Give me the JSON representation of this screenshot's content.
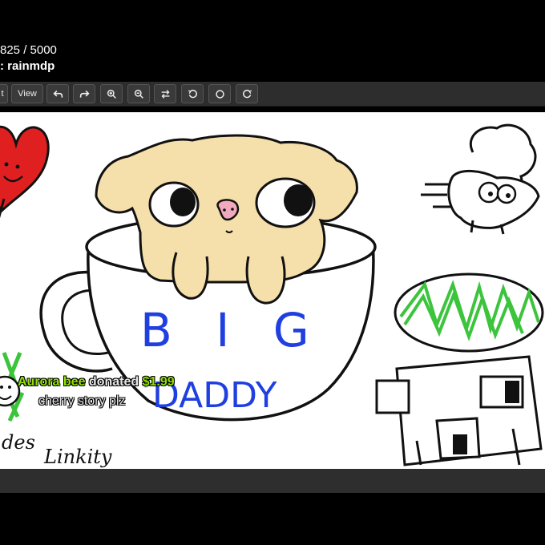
{
  "header": {
    "counter": "825 / 5000",
    "artist": ": rainmdp"
  },
  "toolbar": {
    "first_label": "t",
    "view_label": "View",
    "buttons": [
      {
        "name": "undo-button",
        "icon": "undo-icon"
      },
      {
        "name": "redo-button",
        "icon": "redo-icon"
      },
      {
        "name": "zoom-in-button",
        "icon": "zoom-in-icon"
      },
      {
        "name": "zoom-out-button",
        "icon": "zoom-out-icon"
      },
      {
        "name": "swap-button",
        "icon": "swap-icon"
      },
      {
        "name": "rotate-left-button",
        "icon": "rotate-left-icon"
      },
      {
        "name": "reset-rotation-button",
        "icon": "circle-icon"
      },
      {
        "name": "rotate-right-button",
        "icon": "rotate-right-icon"
      }
    ]
  },
  "drawing": {
    "cup_text_1": "B I G",
    "cup_text_2": "DADDY",
    "signature_1": "des",
    "signature_2": "Linkity"
  },
  "donation": {
    "donor": "Aurora bee",
    "verb": "donated",
    "amount": "$1.99",
    "message": "cherry story plz"
  },
  "colors": {
    "canvas": "#ffffff",
    "toolbar": "#2d2d2d",
    "donation_green": "#8fe000",
    "cup_text_blue": "#1f3fe0",
    "dog_fur": "#f5dfaa",
    "heart_red": "#e02020",
    "melon_green": "#3cc43c"
  }
}
